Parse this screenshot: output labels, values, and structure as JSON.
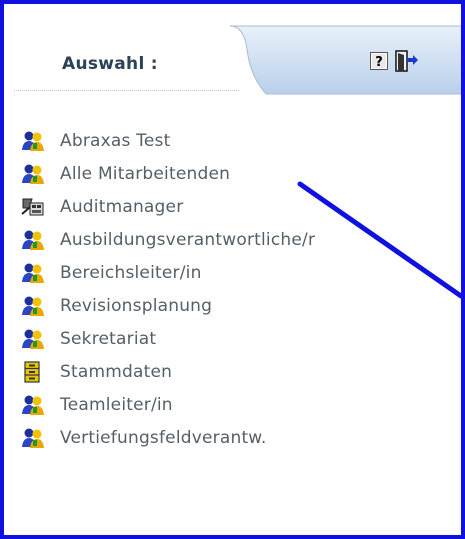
{
  "header": {
    "selection_label": "Auswahl :",
    "help_icon": "help-icon",
    "exit_icon": "exit-door-icon"
  },
  "items": [
    {
      "label": "Abraxas Test",
      "icon": "role-people-icon"
    },
    {
      "label": "Alle Mitarbeitenden",
      "icon": "role-people-icon"
    },
    {
      "label": "Auditmanager",
      "icon": "audit-tool-icon"
    },
    {
      "label": "Ausbildungsverantwortliche/r",
      "icon": "role-people-icon"
    },
    {
      "label": "Bereichsleiter/in",
      "icon": "role-people-icon"
    },
    {
      "label": "Revisionsplanung",
      "icon": "role-people-icon"
    },
    {
      "label": "Sekretariat",
      "icon": "role-people-icon"
    },
    {
      "label": "Stammdaten",
      "icon": "file-cabinet-icon"
    },
    {
      "label": "Teamleiter/in",
      "icon": "role-people-icon"
    },
    {
      "label": "Vertiefungsfeldverantw.",
      "icon": "role-people-icon"
    }
  ],
  "colors": {
    "frame_border": "#1010e0",
    "tab_fill": "#cfe0f4",
    "label_text": "#2b4257",
    "item_text": "#555f68",
    "annotation_line": "#1010e0"
  }
}
